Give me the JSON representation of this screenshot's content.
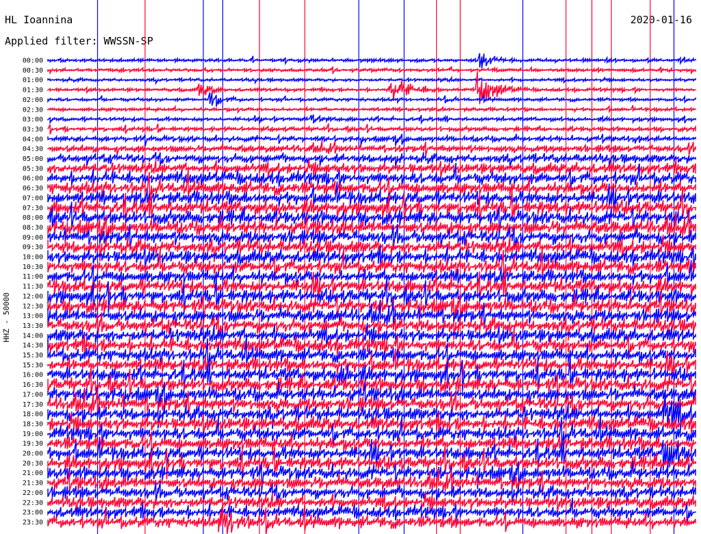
{
  "header": {
    "station": "HL Ioannina",
    "filter_text": "Applied filter: WWSSN-SP",
    "date": "2020-01-16"
  },
  "channel_label": "HHZ - 50000",
  "colors": {
    "trace_a": "#0000ff",
    "trace_b": "#ff0033",
    "background": "#ffffff"
  },
  "chart_data": {
    "type": "line",
    "title": "HL Ioannina",
    "subtitle": "Applied filter: WWSSN-SP",
    "date": "2020-01-16",
    "ylabel": "HHZ - 50000",
    "rows": [
      "00:00",
      "00:30",
      "01:00",
      "01:30",
      "02:00",
      "02:30",
      "03:00",
      "03:30",
      "04:00",
      "04:30",
      "05:00",
      "05:30",
      "06:00",
      "06:30",
      "07:00",
      "07:30",
      "08:00",
      "08:30",
      "09:00",
      "09:30",
      "10:00",
      "10:30",
      "11:00",
      "11:30",
      "12:00",
      "12:30",
      "13:00",
      "13:30",
      "14:00",
      "14:30",
      "15:00",
      "15:30",
      "16:00",
      "16:30",
      "17:00",
      "17:30",
      "18:00",
      "18:30",
      "19:00",
      "19:30",
      "20:00",
      "20:30",
      "21:00",
      "21:30",
      "22:00",
      "22:30",
      "23:00",
      "23:30"
    ],
    "row_tick_labels": [
      "00:00",
      "00:30",
      "01:00",
      "01:30",
      "02:00",
      "02:30",
      "03:00",
      "03:30",
      "04:00",
      "04:30",
      "05:00",
      "05:30",
      "06:00",
      "06:30",
      "07:00",
      "07:30",
      "08:00",
      "08:30",
      "09:00",
      "09:30",
      "10:00",
      "10:30",
      "11:00",
      "11:30",
      "12:00",
      "12:30",
      "13:00",
      "13:30",
      "14:00",
      "14:30",
      "15:30",
      "15:30",
      "16:00",
      "16:30",
      "17:00",
      "17:30",
      "18:00",
      "18:30",
      "19:00",
      "19:30",
      "20:00",
      "20:30",
      "21:00",
      "21:30",
      "22:00",
      "22:30",
      "23:00",
      "23:30"
    ],
    "row_minutes": 30,
    "series_colors": [
      "blue",
      "red"
    ],
    "noise_levels": [
      0.12,
      0.12,
      0.1,
      0.12,
      0.12,
      0.14,
      0.16,
      0.2,
      0.3,
      0.45,
      0.6,
      0.75,
      0.9,
      0.95,
      1.0,
      1.0,
      1.0,
      1.0,
      1.0,
      1.0,
      1.0,
      1.0,
      1.0,
      1.0,
      1.0,
      1.0,
      1.0,
      1.0,
      1.0,
      1.0,
      1.0,
      1.0,
      1.0,
      1.0,
      1.0,
      1.0,
      1.0,
      1.0,
      1.0,
      1.0,
      1.0,
      0.95,
      0.95,
      0.9,
      0.85,
      0.85,
      0.85,
      0.85
    ],
    "events": [
      {
        "row": 0,
        "start_min": 20.0,
        "duration_min": 1.5,
        "amplitude": 1.6
      },
      {
        "row": 3,
        "start_min": 7.0,
        "duration_min": 1.5,
        "amplitude": 1.2
      },
      {
        "row": 3,
        "start_min": 15.8,
        "duration_min": 2.3,
        "amplitude": 2.8
      },
      {
        "row": 3,
        "start_min": 19.9,
        "duration_min": 2.3,
        "amplitude": 2.8
      },
      {
        "row": 4,
        "start_min": 7.5,
        "duration_min": 1.5,
        "amplitude": 1.3
      },
      {
        "row": 6,
        "start_min": 12.2,
        "duration_min": 1.2,
        "amplitude": 0.9
      },
      {
        "row": 32,
        "start_min": 13.5,
        "duration_min": 1.3,
        "amplitude": 2.0
      },
      {
        "row": 47,
        "start_min": 8.0,
        "duration_min": 1.8,
        "amplitude": 2.6
      },
      {
        "row": 36,
        "start_min": 28.5,
        "duration_min": 1.4,
        "amplitude": 4.0
      },
      {
        "row": 40,
        "start_min": 28.5,
        "duration_min": 1.4,
        "amplitude": 3.5
      }
    ],
    "spikes": [
      {
        "minute": 2.3,
        "color": "blue"
      },
      {
        "minute": 4.5,
        "color": "red"
      },
      {
        "minute": 7.2,
        "color": "blue"
      },
      {
        "minute": 8.1,
        "color": "blue"
      },
      {
        "minute": 9.8,
        "color": "red"
      },
      {
        "minute": 11.9,
        "color": "red"
      },
      {
        "minute": 14.4,
        "color": "blue"
      },
      {
        "minute": 16.5,
        "color": "blue"
      },
      {
        "minute": 18.0,
        "color": "red"
      },
      {
        "minute": 19.1,
        "color": "red"
      },
      {
        "minute": 22.0,
        "color": "blue"
      },
      {
        "minute": 24.0,
        "color": "red"
      },
      {
        "minute": 25.2,
        "color": "red"
      },
      {
        "minute": 26.1,
        "color": "red"
      },
      {
        "minute": 27.9,
        "color": "red"
      },
      {
        "minute": 29.0,
        "color": "blue"
      }
    ],
    "grid": false,
    "legend": "none"
  }
}
